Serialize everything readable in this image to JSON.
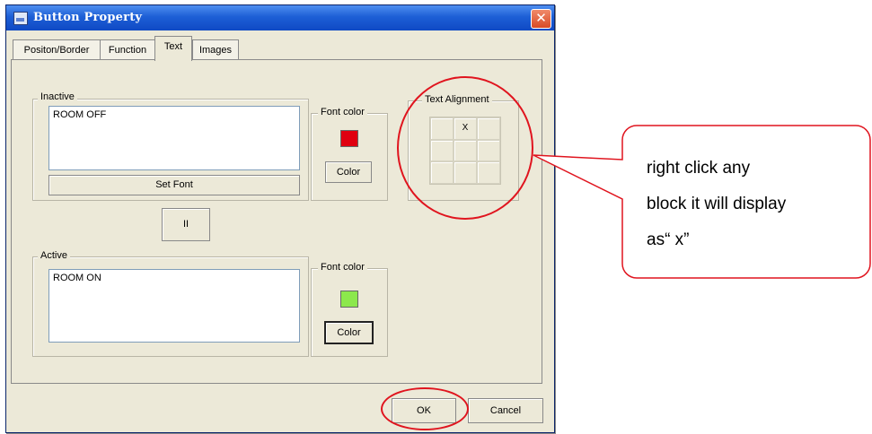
{
  "window": {
    "title": "Button Property",
    "close_glyph": "✕"
  },
  "tabs": [
    {
      "label": "Positon/Border"
    },
    {
      "label": "Function"
    },
    {
      "label": "Text",
      "active": true
    },
    {
      "label": "Images"
    }
  ],
  "inactive": {
    "group_label": "Inactive",
    "text": "ROOM OFF",
    "font_color_label": "Font color",
    "swatch_color": "#e00010",
    "color_button": "Color",
    "set_font_button": "Set Font"
  },
  "swap_button": "II",
  "active": {
    "group_label": "Active",
    "text": "ROOM ON",
    "font_color_label": "Font color",
    "swatch_color": "#8ce84c",
    "color_button": "Color"
  },
  "text_alignment": {
    "label": "Text Alignment",
    "cells": [
      "",
      "X",
      "",
      "",
      "",
      "",
      "",
      "",
      ""
    ]
  },
  "footer": {
    "ok": "OK",
    "cancel": "Cancel"
  },
  "annotation": {
    "lines": [
      "right click any",
      "block it will display",
      "as“ x”"
    ],
    "color": "#e0141e"
  }
}
